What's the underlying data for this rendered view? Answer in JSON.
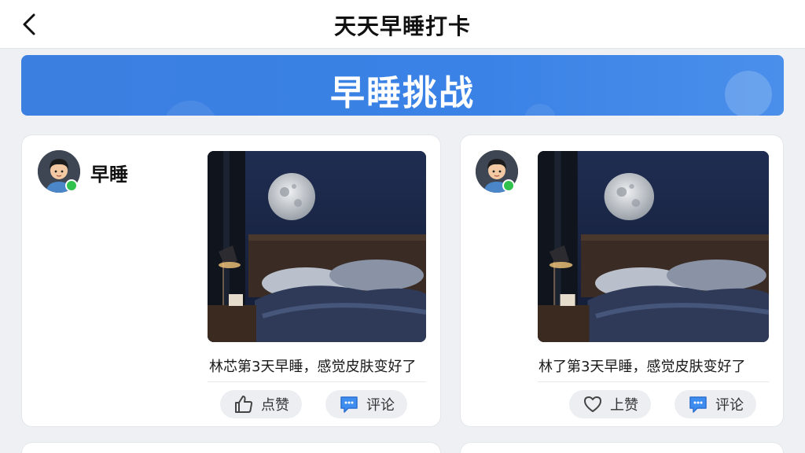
{
  "header": {
    "title": "天天早睡打卡",
    "back_icon": "chevron-left-icon"
  },
  "banner": {
    "title": "早睡挑战",
    "color": "#3b7fe0"
  },
  "posts": [
    {
      "username": "早睡",
      "text": "林芯第3天早睡，感觉皮肤变好了",
      "like_label": "点赞",
      "comment_label": "评论",
      "like_icon": "thumbs-up-icon",
      "comment_icon": "chat-bubble-icon",
      "online_color": "#31c24d"
    },
    {
      "text": "林了第3天早睡，感觉皮肤变好了",
      "like_label": "上赞",
      "comment_label": "评论",
      "like_icon": "heart-icon",
      "comment_icon": "chat-bubble-icon",
      "online_color": "#31c24d"
    }
  ]
}
